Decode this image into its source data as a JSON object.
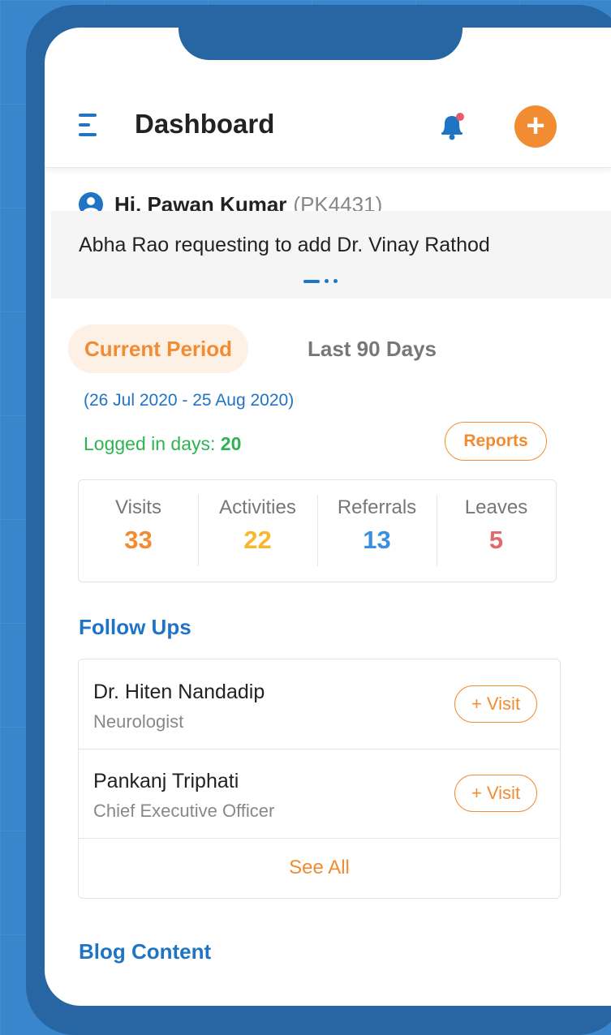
{
  "header": {
    "title": "Dashboard"
  },
  "greeting": {
    "text": "Hi, Pawan Kumar",
    "id": "(PK4431)"
  },
  "banner": {
    "text": "Abha Rao requesting to add Dr. Vinay Rathod"
  },
  "tabs": {
    "current": "Current Period",
    "last": "Last 90 Days"
  },
  "period": {
    "date_range": "(26 Jul 2020 - 25 Aug 2020)",
    "logged_label": "Logged in days: ",
    "logged_value": "20",
    "reports_label": "Reports"
  },
  "stats": [
    {
      "label": "Visits",
      "value": "33",
      "color": "#f28c32"
    },
    {
      "label": "Activities",
      "value": "22",
      "color": "#f5b82e"
    },
    {
      "label": "Referrals",
      "value": "13",
      "color": "#3a8fe0"
    },
    {
      "label": "Leaves",
      "value": "5",
      "color": "#e06b6b"
    }
  ],
  "followups": {
    "title": "Follow Ups",
    "items": [
      {
        "name": "Dr. Hiten Nandadip",
        "role": "Neurologist",
        "action": "+ Visit"
      },
      {
        "name": "Pankanj Triphati",
        "role": "Chief Executive Officer",
        "action": "+ Visit"
      }
    ],
    "see_all": "See All"
  },
  "blog": {
    "title": "Blog Content"
  },
  "colors": {
    "brand_blue": "#1f74c4",
    "accent_orange": "#f28c32",
    "success_green": "#2eb352"
  }
}
